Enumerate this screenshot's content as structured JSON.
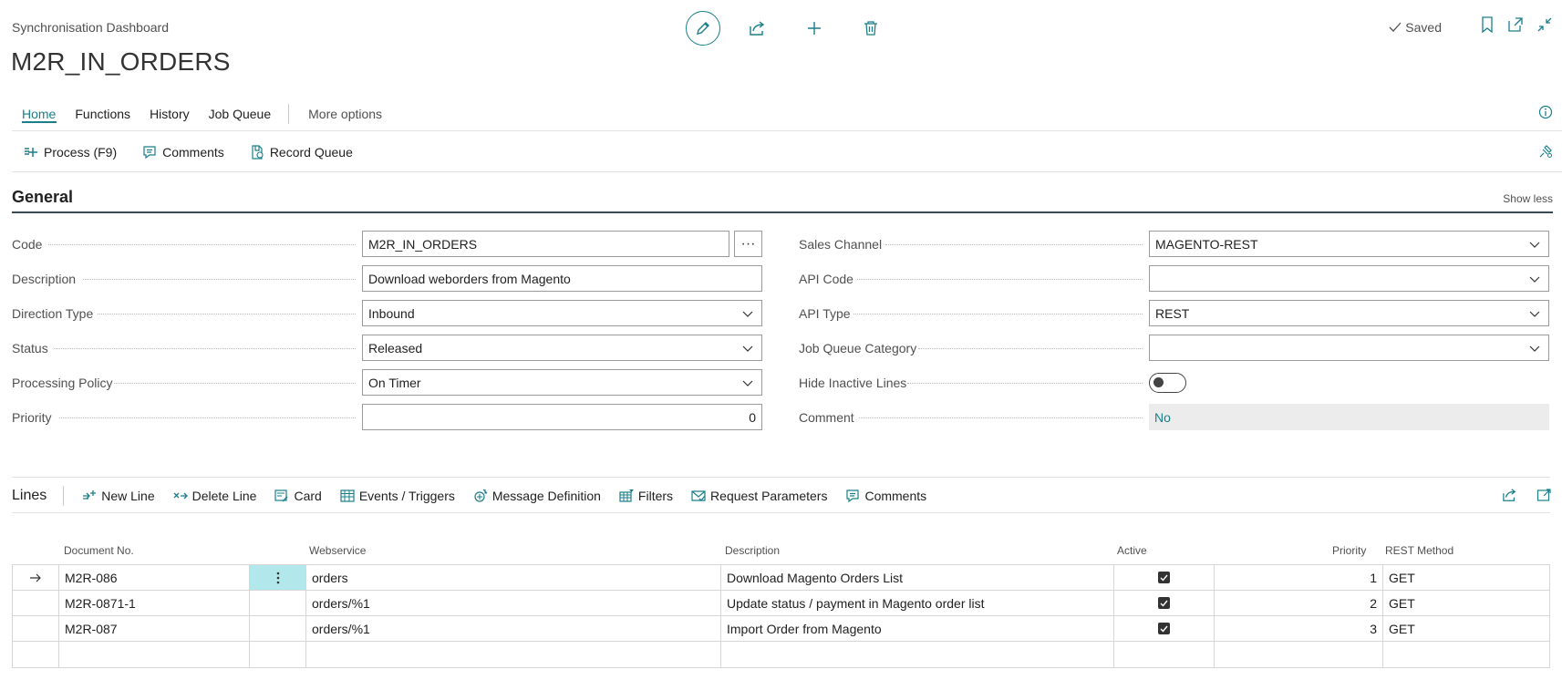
{
  "header": {
    "breadcrumb": "Synchronisation Dashboard",
    "title": "M2R_IN_ORDERS",
    "saved_label": "Saved"
  },
  "nav": {
    "tabs": [
      {
        "label": "Home"
      },
      {
        "label": "Functions"
      },
      {
        "label": "History"
      },
      {
        "label": "Job Queue"
      }
    ],
    "more": "More options"
  },
  "actions": {
    "process": "Process (F9)",
    "comments": "Comments",
    "record_queue": "Record Queue"
  },
  "general": {
    "title": "General",
    "show_less": "Show less",
    "left": {
      "code": {
        "label": "Code",
        "value": "M2R_IN_ORDERS"
      },
      "description": {
        "label": "Description",
        "value": "Download weborders from Magento"
      },
      "direction_type": {
        "label": "Direction Type",
        "value": "Inbound"
      },
      "status": {
        "label": "Status",
        "value": "Released"
      },
      "processing_policy": {
        "label": "Processing Policy",
        "value": "On Timer"
      },
      "priority": {
        "label": "Priority",
        "value": "0"
      }
    },
    "right": {
      "sales_channel": {
        "label": "Sales Channel",
        "value": "MAGENTO-REST"
      },
      "api_code": {
        "label": "API Code",
        "value": ""
      },
      "api_type": {
        "label": "API Type",
        "value": "REST"
      },
      "job_queue_category": {
        "label": "Job Queue Category",
        "value": ""
      },
      "hide_inactive_lines": {
        "label": "Hide Inactive Lines",
        "value": false
      },
      "comment": {
        "label": "Comment",
        "value": "No"
      }
    }
  },
  "lines": {
    "title": "Lines",
    "actions": {
      "new_line": "New Line",
      "delete_line": "Delete Line",
      "card": "Card",
      "events_triggers": "Events / Triggers",
      "message_definition": "Message Definition",
      "filters": "Filters",
      "request_parameters": "Request Parameters",
      "comments": "Comments"
    },
    "columns": {
      "document_no": "Document No.",
      "webservice": "Webservice",
      "description": "Description",
      "active": "Active",
      "priority": "Priority",
      "rest_method": "REST Method"
    },
    "rows": [
      {
        "document_no": "M2R-086",
        "webservice": "orders",
        "description": "Download Magento Orders List",
        "active": true,
        "priority": "1",
        "rest_method": "GET"
      },
      {
        "document_no": "M2R-0871-1",
        "webservice": "orders/%1",
        "description": "Update status / payment in Magento order list",
        "active": true,
        "priority": "2",
        "rest_method": "GET"
      },
      {
        "document_no": "M2R-087",
        "webservice": "orders/%1",
        "description": "Import Order from Magento",
        "active": true,
        "priority": "3",
        "rest_method": "GET"
      }
    ]
  },
  "colors": {
    "accent": "#1a7f8a",
    "selected_cell": "#b2e8eb"
  }
}
